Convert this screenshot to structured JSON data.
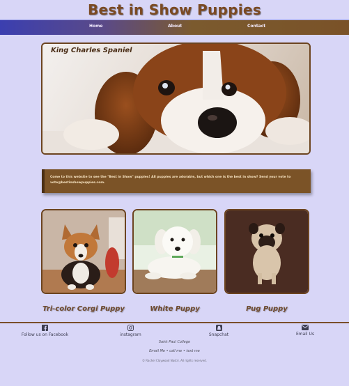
{
  "header": {
    "title": "Best in Show Puppies"
  },
  "nav": {
    "items": [
      {
        "label": "Home"
      },
      {
        "label": "About"
      },
      {
        "label": "Contact"
      }
    ]
  },
  "hero": {
    "caption": "King Charles Spaniel"
  },
  "message": {
    "text": "Come to this website to see the \"Best in Show\" puppies! All puppies are adorable, but which one is the best in show? Send your vote to vote@bestinshowpuppies.com."
  },
  "cards": [
    {
      "title": "Tri-color Corgi Puppy"
    },
    {
      "title": "White Puppy"
    },
    {
      "title": "Pug Puppy"
    }
  ],
  "social": [
    {
      "label": "Follow us on Facebook",
      "icon": "facebook-icon"
    },
    {
      "label": "instagram",
      "icon": "instagram-icon"
    },
    {
      "label": "Snapchat",
      "icon": "snapchat-icon"
    },
    {
      "label": "Email Us",
      "icon": "email-icon"
    }
  ],
  "footer": {
    "school": "Saint Paul College",
    "contact_line": "Email Me • call me • text me",
    "copyright": "© Rachel Claywood Nastri. All rights reserved."
  },
  "colors": {
    "background": "#d8d6f7",
    "brand_brown": "#7b5327",
    "title_brown": "#7b4a22"
  }
}
